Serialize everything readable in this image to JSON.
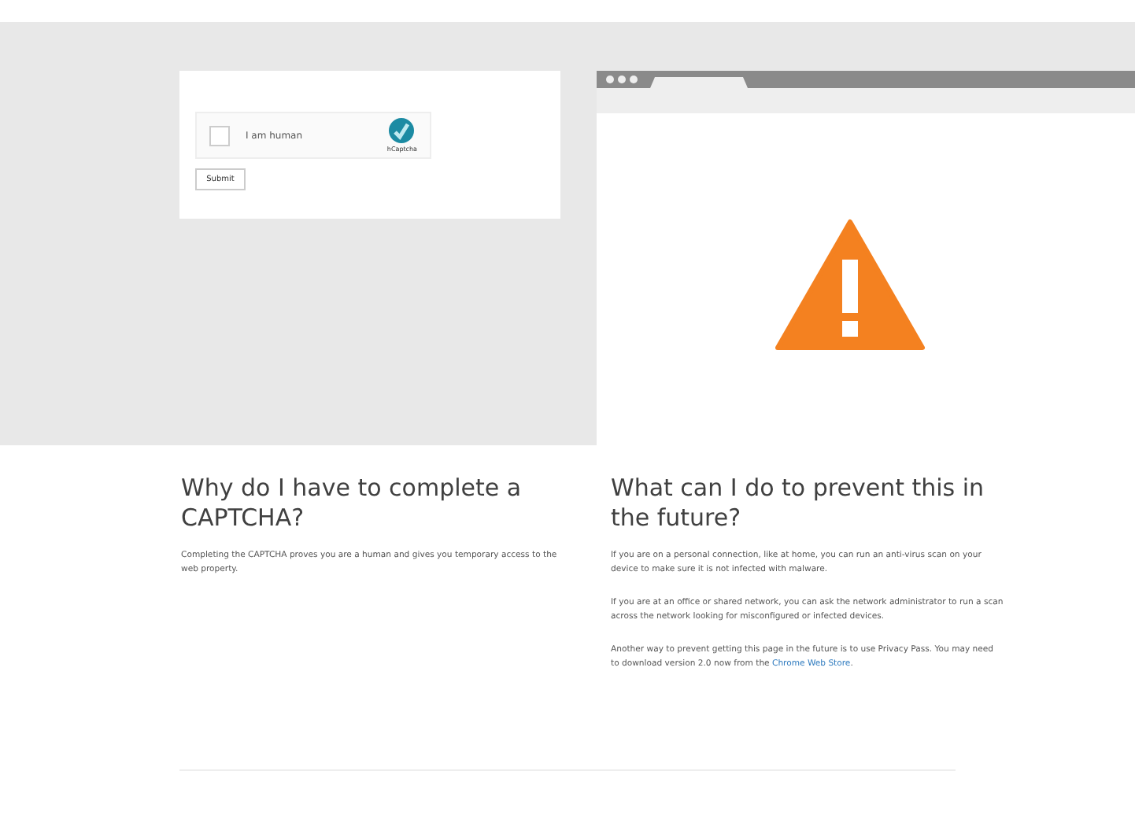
{
  "captcha": {
    "checkbox": {
      "label": "I am human",
      "checked": false
    },
    "logo": "hCaptcha",
    "button": "Submit"
  },
  "left": {
    "heading": "Why do I have to complete a CAPTCHA?",
    "paragraphs": [
      "Completing the CAPTCHA proves you are a human and gives you temporary access to the web property."
    ]
  },
  "right": {
    "heading": "What can I do to prevent this in the future?",
    "paragraphs": [
      "If you are on a personal connection, like at home, you can run an anti-virus scan on your device to make sure it is not infected with malware.",
      "If you are at an office or shared network, you can ask the network administrator to run a scan across the network looking for misconfigured or infected devices."
    ],
    "last": {
      "text": "Another way to prevent getting this page in the future is to use Privacy Pass. You may need to download version 2.0 now from the",
      "link": "Chrome Web Store",
      "end": "."
    }
  }
}
